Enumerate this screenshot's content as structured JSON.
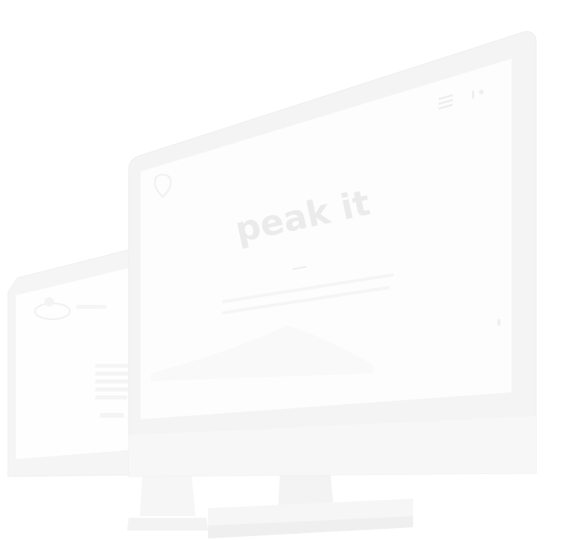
{
  "hero": {
    "title": "peak it"
  },
  "colors": {
    "background": "#ffffff",
    "bezel": "#f5f5f5",
    "bezel_edge": "#efefef",
    "screen": "#fdfdfd",
    "ghost": "#ebebeb",
    "stand": "#f4f4f4"
  },
  "icons": {
    "menu": "hamburger-icon",
    "social_1": "facebook-icon",
    "social_2": "twitter-icon",
    "logo": "location-pin-icon",
    "back_logo": "seal-logo"
  }
}
